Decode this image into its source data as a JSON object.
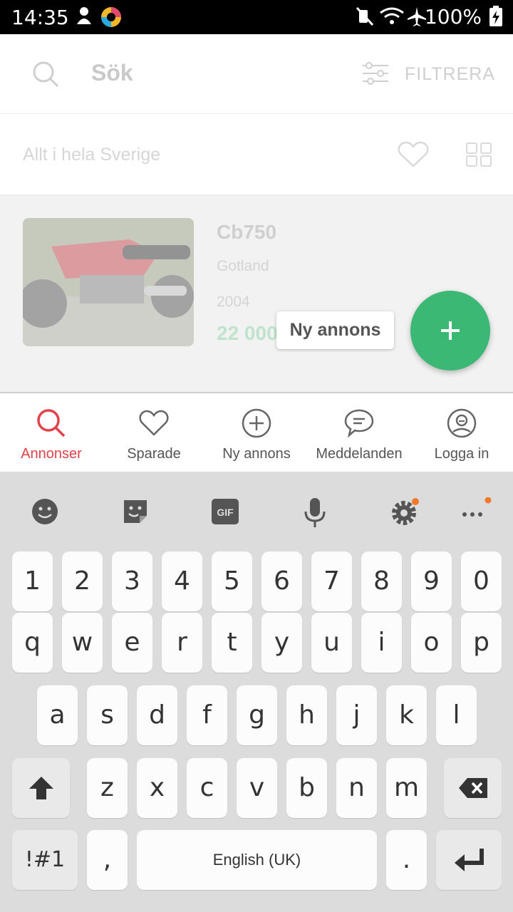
{
  "status_bar": {
    "time": "14:35",
    "battery": "100%"
  },
  "header": {
    "search_label": "Sök",
    "filter_label": "FILTRERA"
  },
  "location": {
    "label": "Allt i hela Sverige"
  },
  "listing": {
    "title": "Cb750",
    "region": "Gotland",
    "year": "2004",
    "price": "22 000"
  },
  "tooltip": {
    "label": "Ny annons"
  },
  "bottom_nav": [
    {
      "label": "Annonser",
      "icon": "search-icon",
      "active": true
    },
    {
      "label": "Sparade",
      "icon": "heart-icon"
    },
    {
      "label": "Ny annons",
      "icon": "add-circle-icon"
    },
    {
      "label": "Meddelanden",
      "icon": "chat-icon"
    },
    {
      "label": "Logga in",
      "icon": "user-icon"
    }
  ],
  "keyboard": {
    "row_numbers": [
      "1",
      "2",
      "3",
      "4",
      "5",
      "6",
      "7",
      "8",
      "9",
      "0"
    ],
    "row_1": [
      "q",
      "w",
      "e",
      "r",
      "t",
      "y",
      "u",
      "i",
      "o",
      "p"
    ],
    "row_2": [
      "a",
      "s",
      "d",
      "f",
      "g",
      "h",
      "j",
      "k",
      "l"
    ],
    "row_3": [
      "z",
      "x",
      "c",
      "v",
      "b",
      "n",
      "m"
    ],
    "symbols": "!#1",
    "comma": ",",
    "space": "English (UK)",
    "period": "."
  },
  "colors": {
    "accent_red": "#e2424a",
    "fab_green": "#3bb873",
    "price_green": "#bfe3cc"
  }
}
